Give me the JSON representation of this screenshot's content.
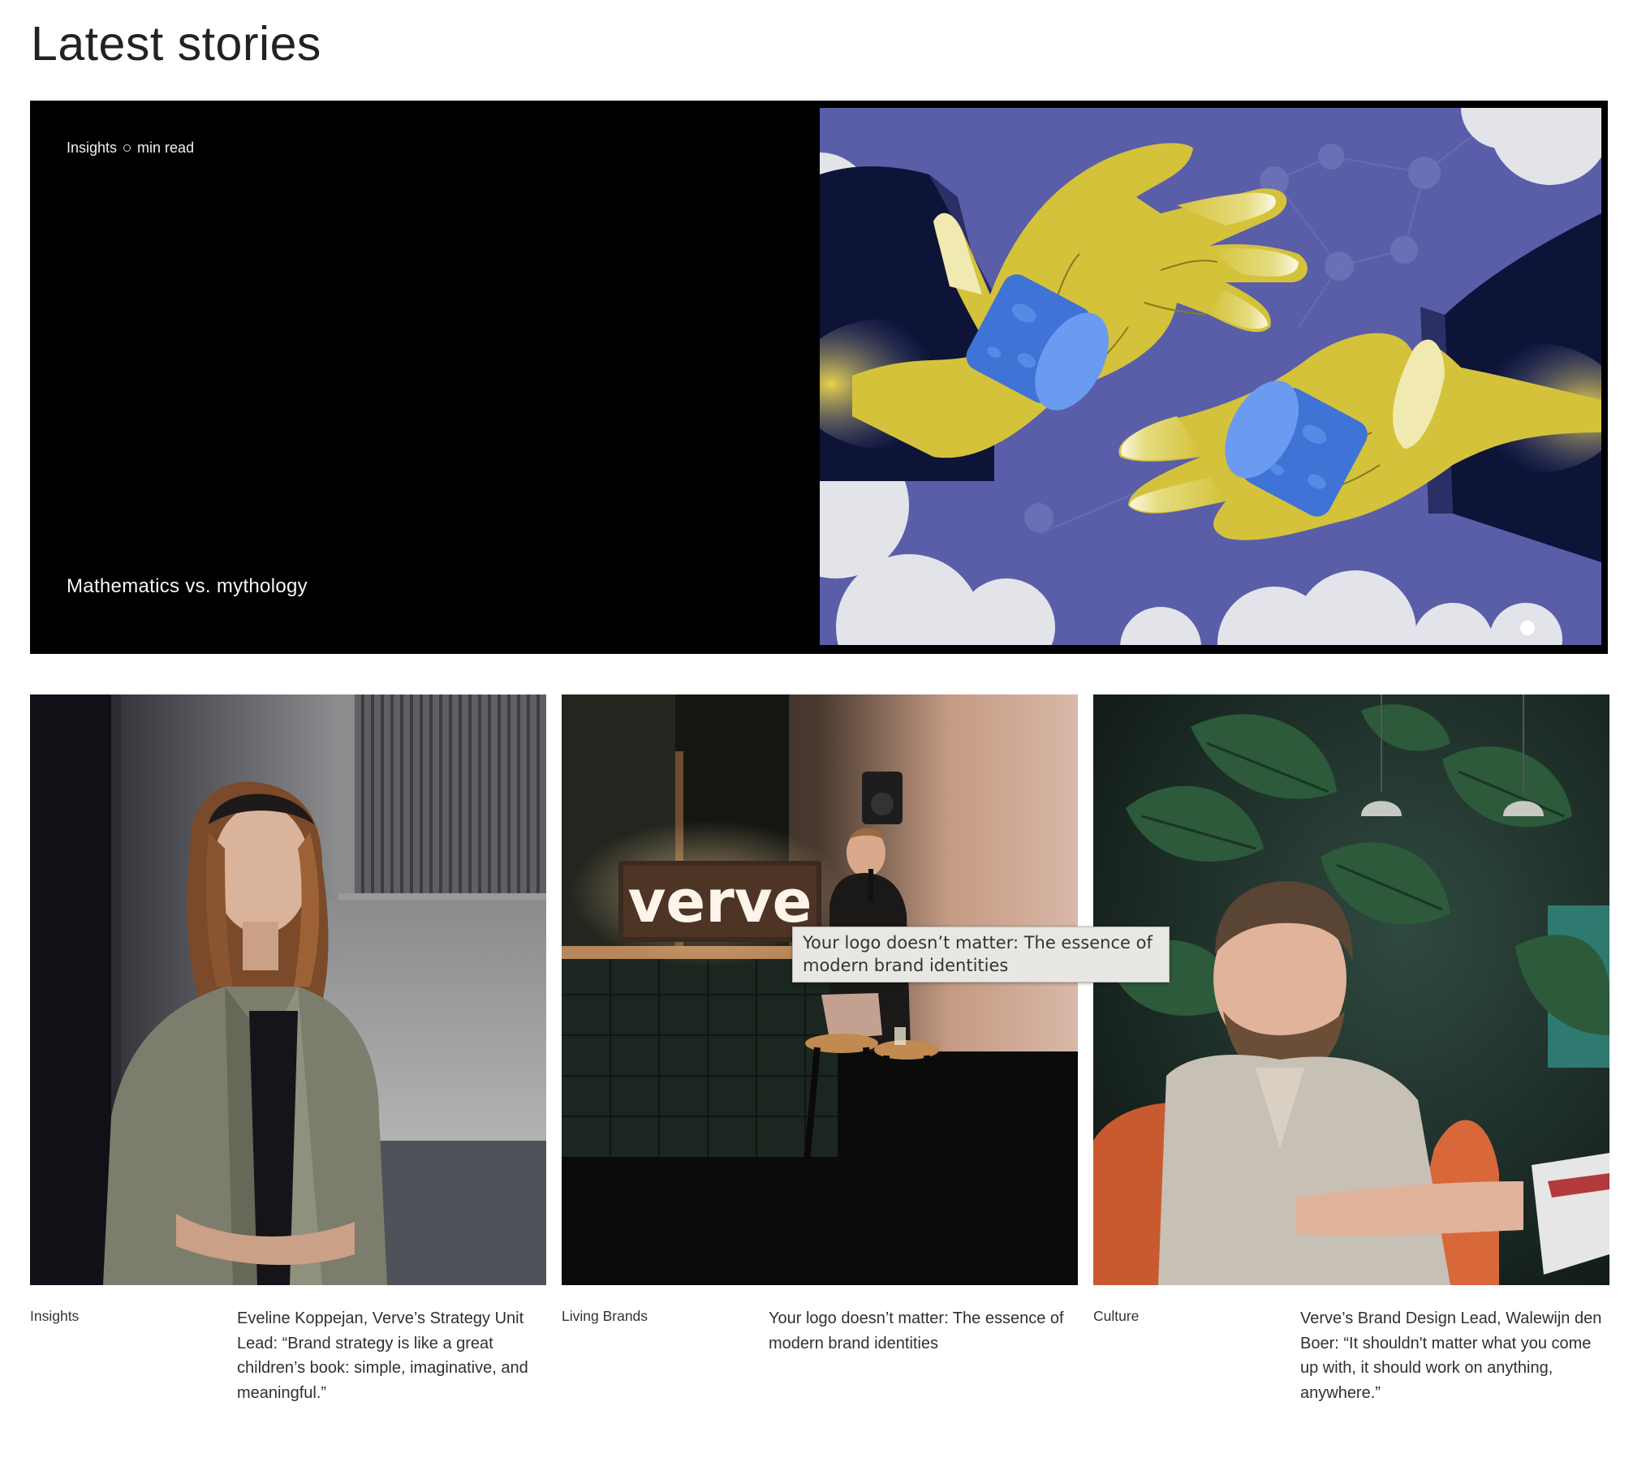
{
  "section": {
    "title": "Latest stories"
  },
  "featured": {
    "category": "Insights",
    "read_time": "min read",
    "title": "Mathematics vs. mythology",
    "image": "illustration of two yellow hands exchanging blue cylinders"
  },
  "cards": [
    {
      "category": "Insights",
      "title": "Eveline Koppejan, Verve’s Strategy Unit Lead: “Brand strategy is like a great children’s book: simple, imaginative, and meaningful.”",
      "image": "portrait photo of woman in light jacket"
    },
    {
      "category": "Living Brands",
      "title": "Your logo doesn’t matter: The essence of modern brand identities",
      "image": "photo of speaker next to illuminated verve sign",
      "sign_text": "verve"
    },
    {
      "category": "Culture",
      "title": "Verve’s Brand Design Lead, Walewijn den Boer: “It shouldn't matter what you come up with, it should work on anything, anywhere.”",
      "image": "portrait photo of man seated in orange chair among plants"
    }
  ],
  "tooltip": {
    "text": "Your logo doesn’t matter: The essence of modern brand identities"
  },
  "colors": {
    "featured_bg": "#000000",
    "illustration_bg": "#5a5ea8",
    "hand_yellow": "#d6c33c",
    "cylinder_blue": "#4f86e6"
  }
}
